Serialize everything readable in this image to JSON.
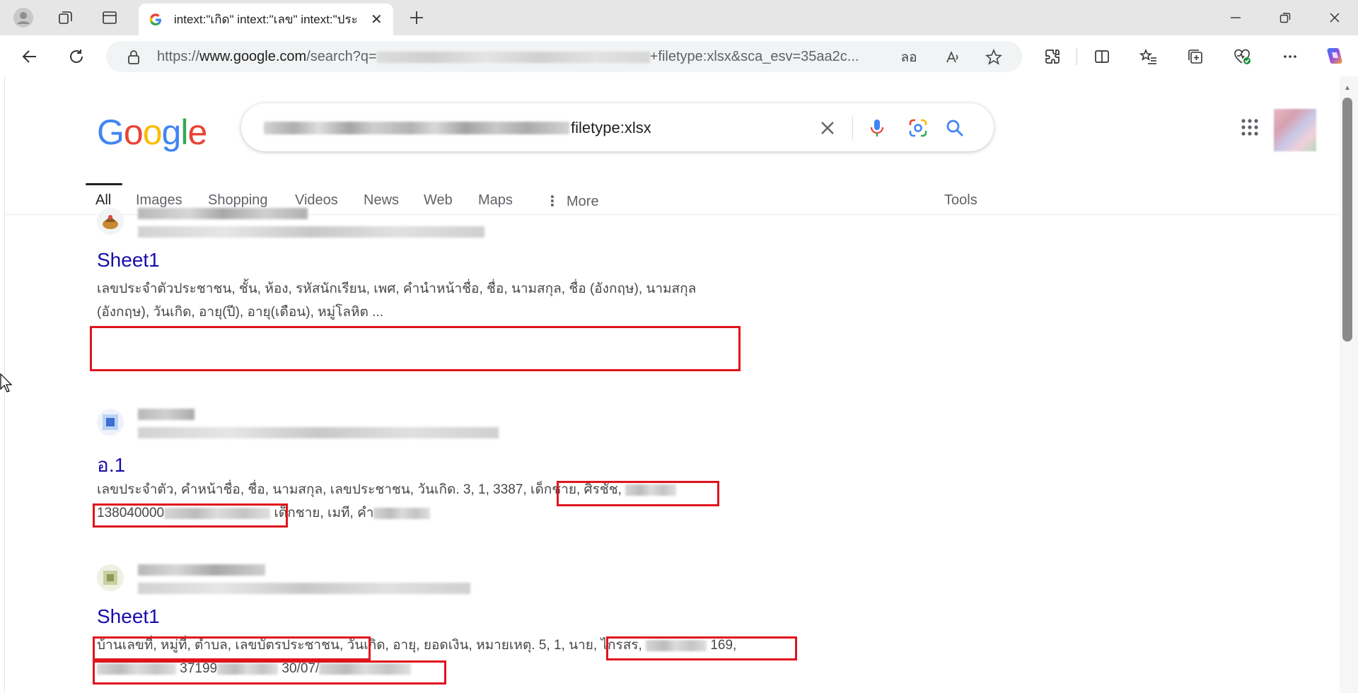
{
  "tab": {
    "title": "intext:\"เกิด\" intext:\"เลข\" intext:\"ประ"
  },
  "address": {
    "url_prefix": "https://",
    "url_host": "www.google.com",
    "url_path": "/search?q=",
    "url_suffix": "+filetype:xlsx&sca_esv=35aa2c..."
  },
  "search": {
    "query_visible": "filetype:xlsx"
  },
  "logo": {
    "letters": [
      "G",
      "o",
      "o",
      "g",
      "l",
      "e"
    ],
    "colors": [
      "#4285F4",
      "#EA4335",
      "#FBBC05",
      "#4285F4",
      "#34A853",
      "#EA4335"
    ]
  },
  "nav": {
    "tabs": [
      "All",
      "Images",
      "Shopping",
      "Videos",
      "News",
      "Web",
      "Maps",
      "More"
    ],
    "tools": "Tools"
  },
  "results": [
    {
      "title": "Sheet1",
      "snippet_line1": "เลขประจำตัวประชาชน, ชั้น, ห้อง, รหัสนักเรียน, เพศ, คำนำหน้าชื่อ, ชื่อ, นามสกุล, ชื่อ (อังกฤษ), นามสกุล",
      "snippet_line2": "(อังกฤษ), วันเกิด, อายุ(ปี), อายุ(เดือน), หมู่โลหิต ..."
    },
    {
      "title": "อ.1",
      "snippet_line1_a": "เลขประจำตัว, คำหน้าชื่อ, ชื่อ, นามสกุล, เลขประชาชน, วันเกิด. 3, 1, 3387,",
      "snippet_line1_b": " เด็กชาย, ศิรชัช,",
      "snippet_line2_a": "138040000",
      "snippet_line2_b": " เด็กชาย, เมที, คำ"
    },
    {
      "title": "Sheet1",
      "snippet_line1_a": "บ้านเลขที่, หมู่ที่, ตำบล, เลขบัตรประชาชน,",
      "snippet_line1_b": " วันเกิด, อายุ, ยอดเงิน, หมายเหตุ. 5, 1,",
      "snippet_line1_c": " นาย, ไกรสร,",
      "snippet_line1_d": " 169,",
      "snippet_line2_a": " 37199",
      "snippet_line2_b": " 30/07/"
    }
  ],
  "colors": {
    "link": "#1a0dab",
    "highlight": "#e0141d",
    "text": "#474747"
  }
}
